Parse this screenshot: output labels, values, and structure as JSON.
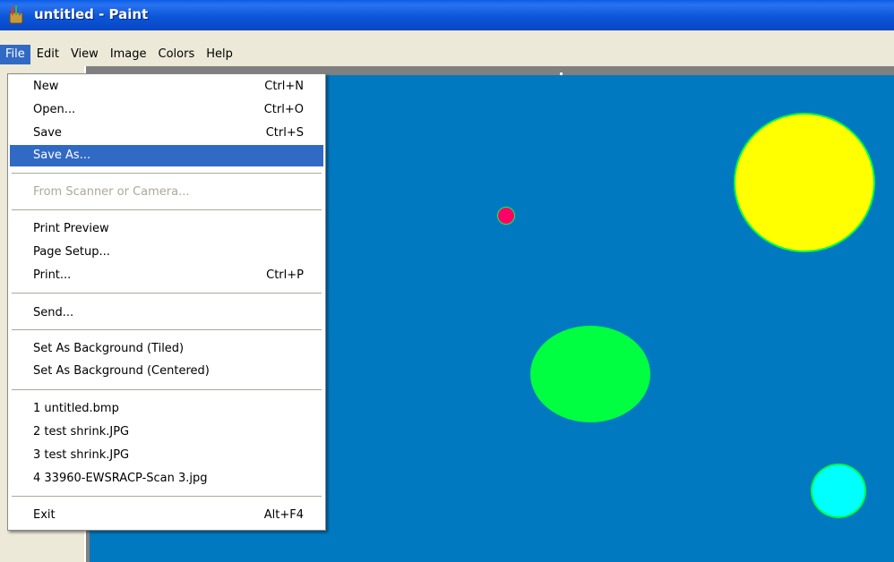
{
  "window": {
    "title": "untitled - Paint"
  },
  "menubar": {
    "items": [
      {
        "label": "File",
        "active": true
      },
      {
        "label": "Edit"
      },
      {
        "label": "View"
      },
      {
        "label": "Image"
      },
      {
        "label": "Colors"
      },
      {
        "label": "Help"
      }
    ]
  },
  "file_menu": {
    "new": {
      "label": "New",
      "shortcut": "Ctrl+N"
    },
    "open": {
      "label": "Open...",
      "shortcut": "Ctrl+O"
    },
    "save": {
      "label": "Save",
      "shortcut": "Ctrl+S"
    },
    "save_as": {
      "label": "Save As..."
    },
    "from_scanner": {
      "label": "From Scanner or Camera..."
    },
    "print_preview": {
      "label": "Print Preview"
    },
    "page_setup": {
      "label": "Page Setup..."
    },
    "print": {
      "label": "Print...",
      "shortcut": "Ctrl+P"
    },
    "send": {
      "label": "Send..."
    },
    "bg_tiled": {
      "label": "Set As Background (Tiled)"
    },
    "bg_centered": {
      "label": "Set As Background (Centered)"
    },
    "recent": [
      "1 untitled.bmp",
      "2 test shrink.JPG",
      "3 test shrink.JPG",
      "4 33960-EWSRACP-Scan 3.jpg"
    ],
    "exit": {
      "label": "Exit",
      "shortcut": "Alt+F4"
    }
  },
  "canvas": {
    "background": "#0079c1",
    "shapes": [
      {
        "name": "yellow-circle",
        "fill": "#ffff00",
        "stroke": "#00ff40"
      },
      {
        "name": "small-pink-circle",
        "fill": "#ff0066",
        "stroke": "#00ff40"
      },
      {
        "name": "green-ellipse",
        "fill": "#00ff40",
        "stroke": "#00ff40"
      },
      {
        "name": "cyan-circle",
        "fill": "#00ffff",
        "stroke": "#00ff40"
      }
    ]
  }
}
